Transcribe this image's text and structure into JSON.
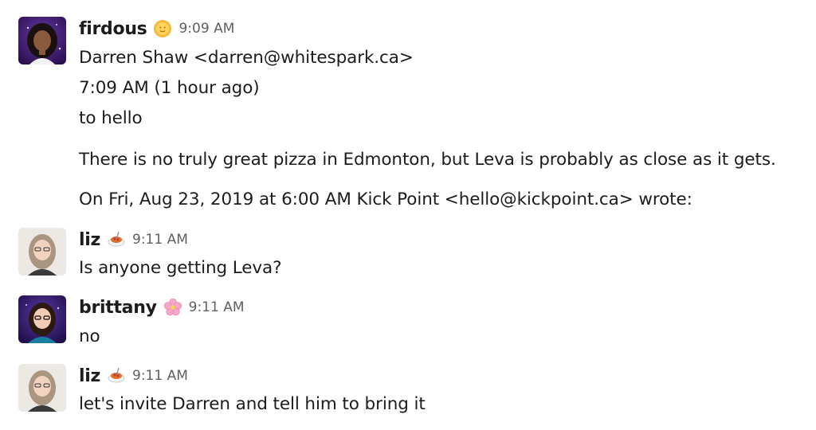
{
  "messages": [
    {
      "author": "firdous",
      "status_emoji": "sun-with-face-emoji",
      "time": "9:09 AM",
      "lines": [
        "Darren Shaw <darren@whitespark.ca>",
        "7:09 AM (1 hour ago)",
        "to hello",
        "There is no truly great pizza in Edmonton, but Leva is probably as close as it gets.",
        "On Fri, Aug 23, 2019 at 6:00 AM Kick Point <hello@kickpoint.ca> wrote:"
      ]
    },
    {
      "author": "liz",
      "status_emoji": "spaghetti-emoji",
      "time": "9:11 AM",
      "lines": [
        "Is anyone getting Leva?"
      ]
    },
    {
      "author": "brittany",
      "status_emoji": "cherry-blossom-emoji",
      "time": "9:11 AM",
      "lines": [
        "no"
      ]
    },
    {
      "author": "liz",
      "status_emoji": "spaghetti-emoji",
      "time": "9:11 AM",
      "lines": [
        "let's invite Darren and tell him to bring it"
      ]
    }
  ]
}
